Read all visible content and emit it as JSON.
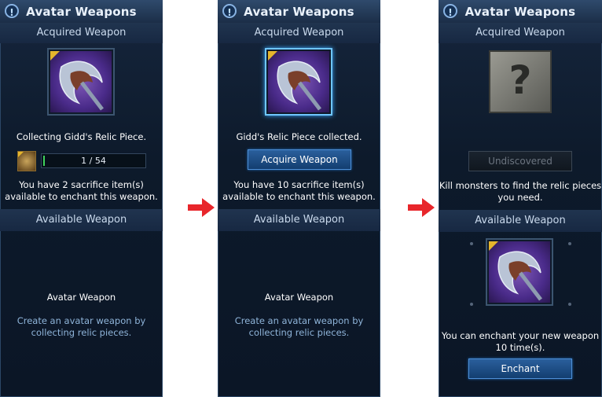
{
  "panel1": {
    "title": "Avatar Weapons",
    "acquired_header": "Acquired Weapon",
    "status": "Collecting Gidd's Relic Piece.",
    "progress_text": "1 / 54",
    "progress_fraction": 0.0185,
    "sacrifice_line1": "You have 2 sacrifice item(s)",
    "sacrifice_line2": "available to enchant this weapon.",
    "available_header": "Available Weapon",
    "avatar_heading": "Avatar Weapon",
    "desc_line1": "Create an avatar weapon by",
    "desc_line2": "collecting relic pieces."
  },
  "panel2": {
    "title": "Avatar Weapons",
    "acquired_header": "Acquired Weapon",
    "status": "Gidd's Relic Piece collected.",
    "acquire_button": "Acquire Weapon",
    "sacrifice_line1": "You have 10 sacrifice item(s)",
    "sacrifice_line2": "available to enchant this weapon.",
    "available_header": "Available Weapon",
    "avatar_heading": "Avatar Weapon",
    "desc_line1": "Create an avatar weapon by",
    "desc_line2": "collecting relic pieces."
  },
  "panel3": {
    "title": "Avatar Weapons",
    "acquired_header": "Acquired Weapon",
    "undiscovered_button": "Undiscovered",
    "kill_line1": "Kill monsters to find the relic pieces",
    "kill_line2": "you need.",
    "available_header": "Available Weapon",
    "enchant_line1": "You can enchant your new weapon",
    "enchant_line2": "10 time(s).",
    "enchant_button": "Enchant"
  },
  "icons": {
    "info": "info-icon",
    "weapon": "axe-weapon-icon",
    "relic": "relic-piece-icon",
    "unknown": "question-mark-icon",
    "arrow": "right-arrow-icon"
  },
  "colors": {
    "panel_bg": "#0d1a2b",
    "accent_blue": "#4e8fd6",
    "progress_green": "#3fd35b",
    "arrow_red": "#e8262b",
    "corner_gold": "#e5b52c"
  }
}
